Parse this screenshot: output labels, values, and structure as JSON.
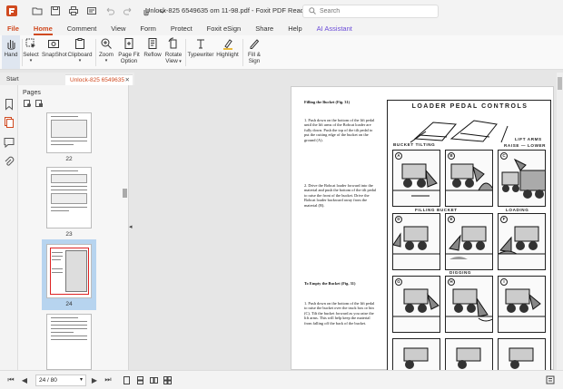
{
  "app": {
    "title": "Unlock-825 6549635 om 11-98.pdf - Foxit PDF Reader",
    "search_placeholder": "Search"
  },
  "menu": {
    "items": [
      "File",
      "Home",
      "Comment",
      "View",
      "Form",
      "Protect",
      "Foxit eSign",
      "Share",
      "Help",
      "AI Assistant"
    ],
    "active": "Home"
  },
  "ribbon": {
    "hand": "Hand",
    "select": "Select",
    "snapshot": "SnapShot",
    "clipboard": "Clipboard",
    "zoom": "Zoom",
    "page_fit_1": "Page Fit",
    "page_fit_2": "Option",
    "reflow": "Reflow",
    "rotate_1": "Rotate",
    "rotate_2": "View",
    "typewriter": "Typewriter",
    "highlight": "Highlight",
    "fillsign_1": "Fill &",
    "fillsign_2": "Sign"
  },
  "tabs": {
    "start": "Start",
    "doc": "Unlock-825 6549635"
  },
  "pages_panel": {
    "title": "Pages",
    "thumbnails": [
      "22",
      "23",
      "24"
    ],
    "selected": "24"
  },
  "document": {
    "heading1": "Filling the Bucket (Fig. 31)",
    "step1": "1. Push down on the bottom of the lift pedal until the lift arms of the Bobcat loader are fully down. Push the top of the tilt pedal to put the cutting edge of the bucket on the ground (A).",
    "step2": "2. Drive the Bobcat loader forward into the material and push the bottom of the tilt pedal to raise the front of the bucket. Drive the Bobcat loader backward away from the material (B).",
    "heading2": "To Empty the Bucket (Fig. 31)",
    "step3": "1. Push down on the bottom of the lift pedal to raise the bucket over the truck box or bin (C). Tilt the bucket forward as you raise the lift arms. This will help keep the material from falling off the back of the bucket.",
    "diagram_title": "LOADER PEDAL CONTROLS",
    "label_tilting": "BUCKET TILTING",
    "label_lift": "LIFT ARMS",
    "label_raise": "RAISE — LOWER",
    "label_filling": "FILLING BUCKET",
    "label_loading": "LOADING",
    "label_digging": "DIGGING",
    "cells": [
      "A",
      "B",
      "C",
      "D",
      "E",
      "F",
      "G",
      "H",
      "I"
    ]
  },
  "status": {
    "page_display": "24 / 80"
  },
  "colors": {
    "accent": "#d04a20",
    "ai": "#6a4bd8",
    "selection": "#b7d4ef"
  }
}
